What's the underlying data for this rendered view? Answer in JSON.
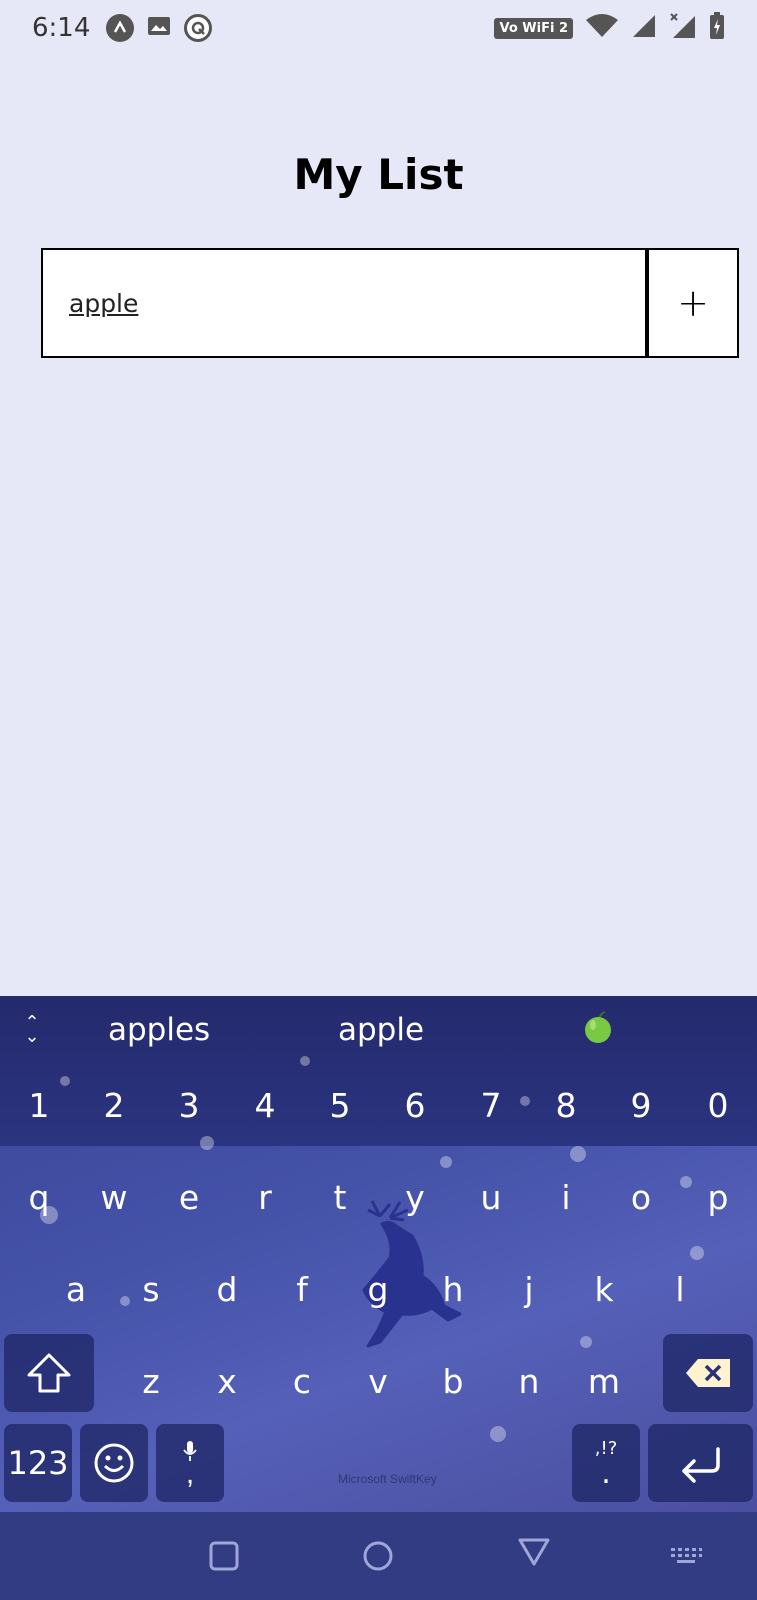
{
  "status_bar": {
    "time": "6:14",
    "vowifi_label": "Vo WiFi 2"
  },
  "page": {
    "title": "My List"
  },
  "item_input": {
    "value": "apple"
  },
  "add_button": {
    "label": "+"
  },
  "keyboard": {
    "suggestions": [
      "apples",
      "apple"
    ],
    "suggestion_emoji": "green-apple-emoji",
    "number_row": [
      "1",
      "2",
      "3",
      "4",
      "5",
      "6",
      "7",
      "8",
      "9",
      "0"
    ],
    "row1": [
      "q",
      "w",
      "e",
      "r",
      "t",
      "y",
      "u",
      "i",
      "o",
      "p"
    ],
    "row2": [
      "a",
      "s",
      "d",
      "f",
      "g",
      "h",
      "j",
      "k",
      "l"
    ],
    "row3": [
      "z",
      "x",
      "c",
      "v",
      "b",
      "n",
      "m"
    ],
    "numbers_key": "123",
    "comma_key": ",",
    "punct_key_top": ",!?",
    "punct_key_bottom": ".",
    "brand": "Microsoft SwiftKey"
  },
  "colors": {
    "background": "#e6e7f7",
    "keyboard_top": "#242a6c",
    "keyboard_body": "#4452a8",
    "nav_bar": "#323c82"
  }
}
